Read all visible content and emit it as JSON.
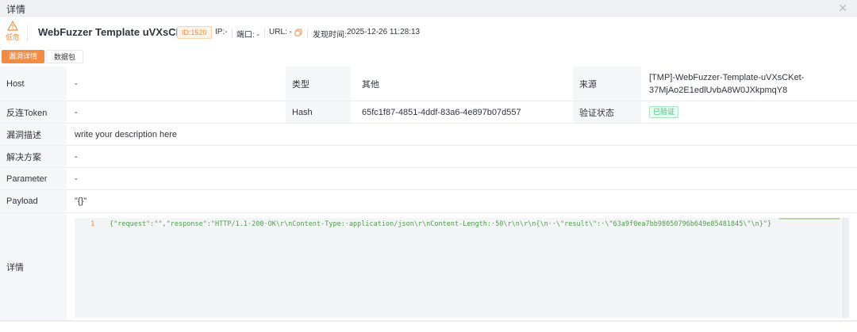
{
  "window": {
    "title": "详情"
  },
  "header": {
    "risk_label": "低危",
    "title": "WebFuzzer Template uVXsCKet",
    "id_tag": "ID:1520",
    "ip_label": "IP:-",
    "port_label": "端口: -",
    "url_label": "URL: -",
    "found_time_label": "发现时间:",
    "found_time": "2025-12-26 11:28:13"
  },
  "tabs": [
    {
      "label": "漏洞详情",
      "active": true
    },
    {
      "label": "数据包",
      "active": false
    }
  ],
  "table": {
    "host_label": "Host",
    "host_value": "-",
    "type_label": "类型",
    "type_value": "其他",
    "source_label": "来源",
    "source_value_line1": "[TMP]-WebFuzzer-Template-uVXsCKet-",
    "source_value_line2": "37MjAo2E1edlUvbA8W0JXkpmqY8",
    "token_label": "反连Token",
    "token_value": "-",
    "hash_label": "Hash",
    "hash_value": "65fc1f87-4851-4ddf-83a6-4e897b07d557",
    "verify_label": "验证状态",
    "verify_value": "已验证",
    "desc_label": "漏洞描述",
    "desc_value": "write your description here",
    "solution_label": "解决方案",
    "solution_value": "-",
    "parameter_label": "Parameter",
    "parameter_value": "-",
    "payload_label": "Payload",
    "payload_value": "\"{}\"",
    "detail_label": "详情"
  },
  "code": {
    "line_number": "1",
    "content": "{\"request\":\"\",\"response\":\"HTTP/1.1·200·OK\\r\\nContent-Type:·application/json\\r\\nContent-Length:·50\\r\\n\\r\\n{\\n··\\\"result\\\":·\\\"63a9f0ea7bb98050796b649e85481845\\\"\\n}\"}"
  },
  "colors": {
    "accent": "#f28b44",
    "verified": "#3ac67d"
  }
}
